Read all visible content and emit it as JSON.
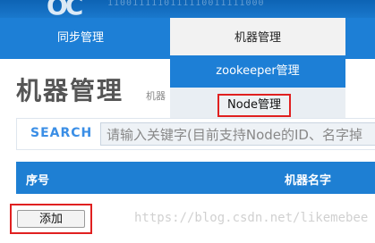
{
  "banner": {
    "logo_text": "OC",
    "bits_text": "1100111110111110011111000"
  },
  "nav": {
    "sync_label": "同步管理",
    "machine_label": "机器管理"
  },
  "dropdown": {
    "zookeeper_label": "zookeeper管理",
    "node_label": "Node管理"
  },
  "page": {
    "title": "机器管理",
    "sub_crumb": "机器"
  },
  "search": {
    "label": "SEARCH",
    "placeholder": "请输入关键字(目前支持Node的ID、名字掉"
  },
  "table": {
    "headers": [
      "序号",
      "机器名字"
    ]
  },
  "actions": {
    "add_label": "添加"
  },
  "watermark": "https://blog.csdn.net/likemebee",
  "colors": {
    "nav_blue": "#1d7fd6",
    "highlight_red": "#e02020",
    "search_label_blue": "#3a8ee6"
  }
}
